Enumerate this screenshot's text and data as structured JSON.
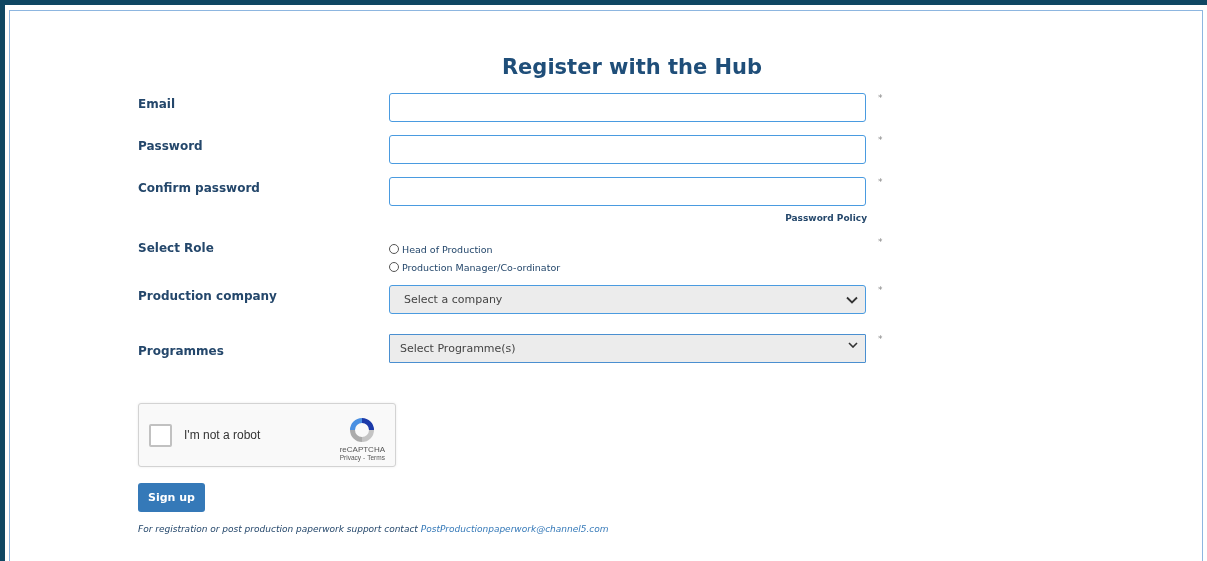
{
  "title": "Register with the Hub",
  "fields": [
    {
      "kind": "text",
      "label": "Email",
      "required_mark": "*"
    },
    {
      "kind": "text",
      "label": "Password",
      "required_mark": "*"
    },
    {
      "kind": "text",
      "label": "Confirm password",
      "required_mark": "*"
    }
  ],
  "password_policy_link": "Password Policy",
  "role": {
    "label": "Select Role",
    "required_mark": "*",
    "options": [
      {
        "label": "Head of Production",
        "selected": false
      },
      {
        "label": "Production Manager/Co-ordinator",
        "selected": false
      }
    ]
  },
  "company": {
    "label": "Production company",
    "value": "Select a company",
    "required_mark": "*"
  },
  "programmes": {
    "label": "Programmes",
    "value": "Select Programme(s)",
    "required_mark": "*"
  },
  "captcha": {
    "label": "I'm not a robot",
    "checked": false,
    "brand": "reCAPTCHA",
    "privacy": "Privacy",
    "separator": "-",
    "terms": "Terms"
  },
  "submit": "Sign up",
  "footer": {
    "text": "For registration or post production paperwork support contact",
    "email": "PostProductionpaperwork@channel5.com"
  }
}
